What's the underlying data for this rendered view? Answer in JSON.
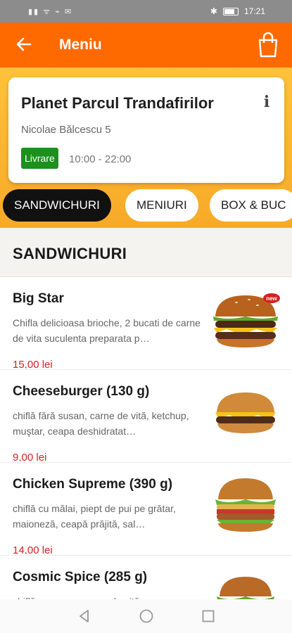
{
  "status_bar": {
    "left_icons": "▮▮ ᯤ ⌁ ✉",
    "bluetooth": "✱",
    "time": "17:21"
  },
  "header": {
    "title": "Meniu"
  },
  "store": {
    "name": "Planet Parcul Trandafirilor",
    "address": "Nicolae Bălcescu 5",
    "delivery_label": "Livrare",
    "hours": "10:00 - 22:00"
  },
  "tabs": [
    {
      "label": "SANDWICHURI",
      "active": true
    },
    {
      "label": "MENIURI",
      "active": false
    },
    {
      "label": "BOX & BUC",
      "active": false
    }
  ],
  "section": {
    "title": "SANDWICHURI"
  },
  "products": [
    {
      "name": "Big Star",
      "description": "Chifla delicioasa brioche, 2 bucati de carne de vita suculenta preparata p…",
      "price": "15,00 lei",
      "badge": "new"
    },
    {
      "name": "Cheeseburger (130 g)",
      "description": "chiflă fără susan, carne de vită, ketchup, muştar, ceapa deshidratat…",
      "price": "9,00 lei"
    },
    {
      "name": "Chicken Supreme (390 g)",
      "description": "chiflă cu mălai, piept de pui pe grătar, maioneză, ceapă prăjită, sal…",
      "price": "14,00 lei"
    },
    {
      "name": "Cosmic Spice (285 g)",
      "description": "chiflă cu susan, carne de vită, cea…",
      "price": ""
    }
  ],
  "colors": {
    "brand": "#ff6a00",
    "band": "#ffc23a",
    "delivery": "#1c8f1c",
    "price": "#d32222"
  },
  "icons": {
    "back": "arrow-left-icon",
    "bag": "shopping-bag-icon",
    "info": "info-icon"
  }
}
